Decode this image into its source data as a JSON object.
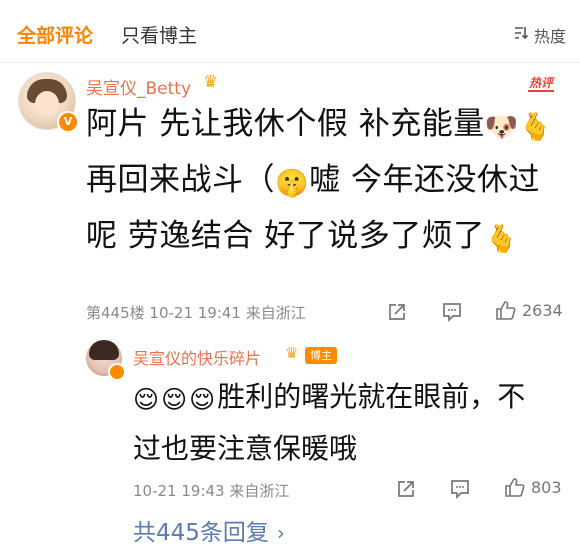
{
  "tabs": {
    "all": "全部评论",
    "blogger": "只看博主",
    "sort": "热度"
  },
  "comment": {
    "author": "吴宣仪_Betty",
    "hot_label": "热评",
    "text_parts": [
      "阿片 先让我休个假 补充能量",
      "再回来战斗（",
      "嘘 今年还没休过呢 劳逸结合 好了说多了烦了"
    ],
    "meta": "第445楼 10-21 19:41 来自浙江",
    "likes": "2634"
  },
  "reply": {
    "author": "吴宣仪的快乐碎片",
    "blogger_tag": "博主",
    "text": "胜利的曙光就在眼前，不过也要注意保暖哦",
    "meta": "10-21 19:43 来自浙江",
    "likes": "803"
  },
  "replies_link": "共445条回复",
  "icons": {
    "sort": "sort-icon",
    "share": "share-icon",
    "comment": "comment-icon",
    "like": "like-icon",
    "doge": "doge-emoji",
    "finger_heart": "finger-heart-emoji",
    "shush": "shush-emoji",
    "relieved": "relieved-emoji",
    "crown": "crown-icon",
    "verified": "verified-icon"
  },
  "colors": {
    "accent": "#ff8200",
    "name": "#eb7350",
    "link": "#5b7bb2",
    "meta": "#8a8a8a"
  }
}
